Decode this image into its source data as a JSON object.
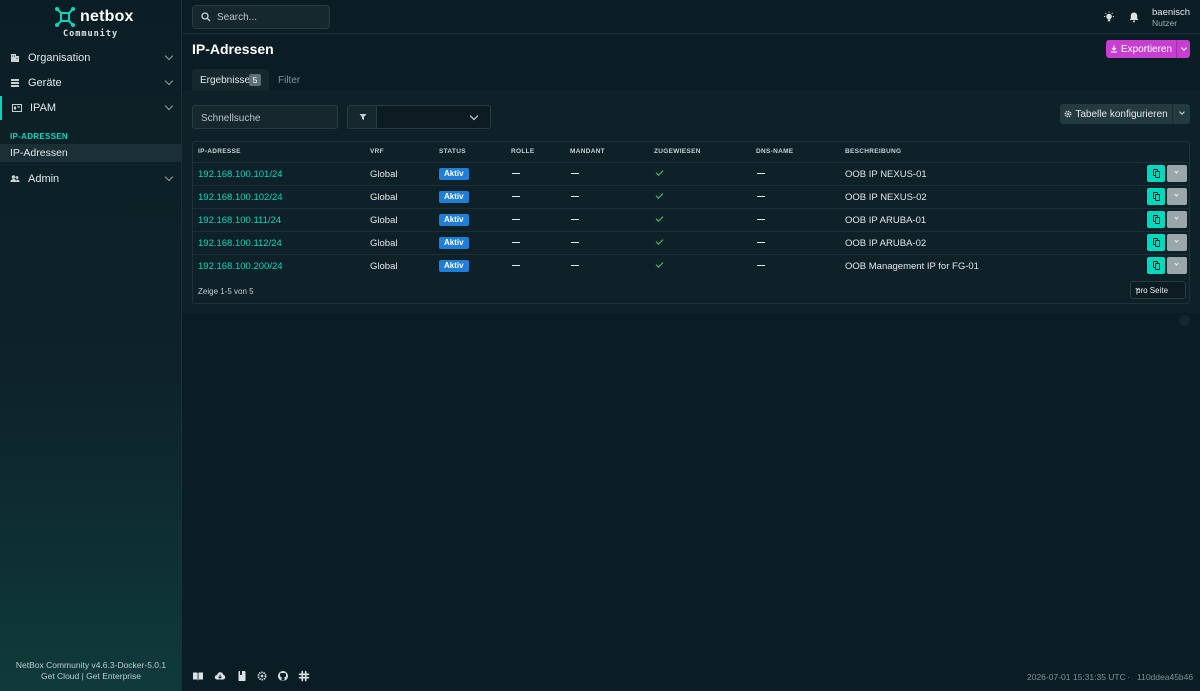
{
  "brand": {
    "name": "netbox",
    "sub": "Community"
  },
  "sidebar": {
    "items": [
      {
        "label": "Organisation",
        "icon": "domain-icon"
      },
      {
        "label": "Geräte",
        "icon": "server-icon"
      },
      {
        "label": "IPAM",
        "icon": "counter-icon"
      },
      {
        "label": "Admin",
        "icon": "account-multiple-icon"
      }
    ],
    "section_head": "IP-ADRESSEN",
    "sub_item": "IP-Adressen",
    "footer_version": "NetBox Community v4.6.3-Docker-5.0.1",
    "footer_links": "Get Cloud | Get Enterprise"
  },
  "topbar": {
    "search_placeholder": "Search...",
    "user_name": "baenisch",
    "user_role": "Nutzer"
  },
  "page": {
    "title": "IP-Adressen",
    "export_label": "Exportieren",
    "accent": "#c63fd1",
    "tabs": {
      "results_label": "Ergebnisse",
      "results_count": "5",
      "filter_label": "Filter"
    },
    "quick_search_placeholder": "Schnellsuche",
    "config_label": "Tabelle konfigurieren"
  },
  "table": {
    "columns": [
      "IP-ADRESSE",
      "VRF",
      "STATUS",
      "ROLLE",
      "MANDANT",
      "ZUGEWIESEN",
      "DNS-NAME",
      "BESCHREIBUNG"
    ],
    "rows": [
      {
        "address": "192.168.100.101/24",
        "vrf": "Global",
        "status": "Aktiv",
        "description": "OOB IP NEXUS-01"
      },
      {
        "address": "192.168.100.102/24",
        "vrf": "Global",
        "status": "Aktiv",
        "description": "OOB IP NEXUS-02"
      },
      {
        "address": "192.168.100.111/24",
        "vrf": "Global",
        "status": "Aktiv",
        "description": "OOB IP ARUBA-01"
      },
      {
        "address": "192.168.100.112/24",
        "vrf": "Global",
        "status": "Aktiv",
        "description": "OOB IP ARUBA-02"
      },
      {
        "address": "192.168.100.200/24",
        "vrf": "Global",
        "status": "Aktiv",
        "description": "OOB Management IP for FG-01"
      }
    ],
    "footer": "Zeige 1-5 von 5",
    "per_page_label": "pro Seite"
  },
  "bottombar": {
    "timestamp": "2026-07-01 15:31:35 UTC",
    "separator": "·",
    "hash": "110ddea45b46"
  }
}
